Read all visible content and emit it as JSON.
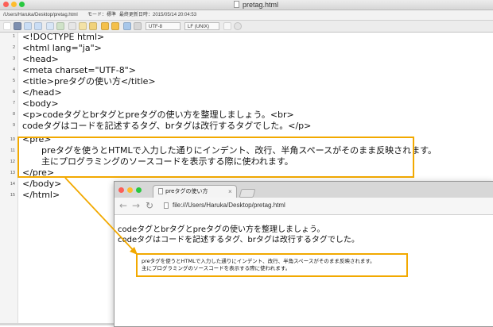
{
  "editor": {
    "window_title": "pretag.html",
    "info": {
      "path": "/Users/Haruka/Desktop/pretag.html",
      "mode": "モード：標準",
      "saved": "最終更新日時：2015/05/14 20:04:53"
    },
    "toolbar": {
      "encoding": "UTF-8",
      "line_ending": "LF (UNIX)"
    },
    "lines": [
      {
        "num": "1",
        "text": "<!DOCTYPE html>"
      },
      {
        "num": "2",
        "text": "<html lang=\"ja\">"
      },
      {
        "num": "3",
        "text": "<head>"
      },
      {
        "num": "4",
        "text": "<meta charset=\"UTF-8\">"
      },
      {
        "num": "5",
        "text": "<title>preタグの使い方</title>"
      },
      {
        "num": "6",
        "text": "</head>"
      },
      {
        "num": "7",
        "text": "<body>"
      },
      {
        "num": "8",
        "text": "<p>codeタグとbrタグとpreタグの使い方を整理しましょう。<br>"
      },
      {
        "num": "9",
        "text": "codeタグはコードを記述するタグ、brタグは改行するタグでした。</p>"
      },
      {
        "num": "10",
        "text": "<pre>"
      },
      {
        "num": "11",
        "text": "preタグを使うとHTMLで入力した通りにインデント、改行、半角スペースがそのまま反映されます。"
      },
      {
        "num": "12",
        "text": "主にプログラミングのソースコードを表示する際に使われます。"
      },
      {
        "num": "13",
        "text": "</pre>"
      },
      {
        "num": "14",
        "text": "</body>"
      },
      {
        "num": "15",
        "text": "</html>"
      }
    ]
  },
  "browser": {
    "tab_label": "preタグの使い方",
    "tab_close": "×",
    "url": "file:///Users/Haruka/Desktop/pretag.html",
    "content": {
      "p_line1": "codeタグとbrタグとpreタグの使い方を整理しましょう。",
      "p_line2": "codeタグはコードを記述するタグ、brタグは改行するタグでした。",
      "pre_line1": "preタグを使うとHTMLで入力した通りにインデント、改行、半角スペースがそのまま反映されます。",
      "pre_line2": "主にプログラミングのソースコードを表示する際に使われます。"
    }
  },
  "colors": {
    "highlight": "#f2a900",
    "close": "#fc5f57",
    "minimize": "#fdbc2e",
    "zoom": "#28c840"
  }
}
